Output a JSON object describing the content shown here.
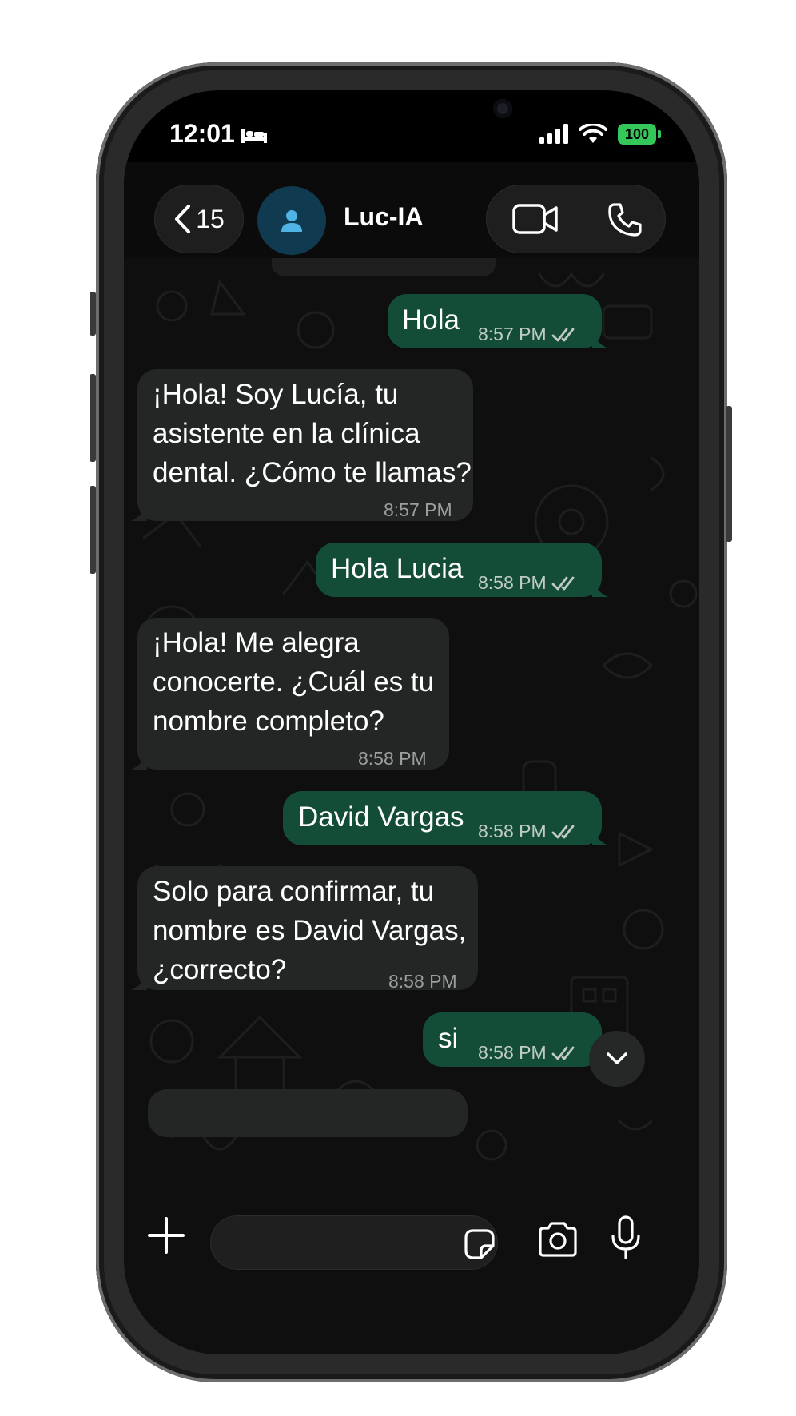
{
  "status_bar": {
    "time": "12:01",
    "battery": "100"
  },
  "header": {
    "back_count": "15",
    "contact_name": "Luc-IA"
  },
  "messages": [
    {
      "direction": "out",
      "text": "Hola",
      "time": "8:57 PM"
    },
    {
      "direction": "in",
      "text": "¡Hola! Soy Lucía, tu\nasistente en la clínica\ndental. ¿Cómo te llamas?",
      "time": "8:57 PM"
    },
    {
      "direction": "out",
      "text": "Hola Lucia",
      "time": "8:58 PM"
    },
    {
      "direction": "in",
      "text": "¡Hola! Me alegra\nconocerte. ¿Cuál es tu\nnombre completo?",
      "time": "8:58 PM"
    },
    {
      "direction": "out",
      "text": "David Vargas",
      "time": "8:58 PM"
    },
    {
      "direction": "in",
      "text": "Solo para confirmar, tu\nnombre es David Vargas,\n¿correcto?",
      "time": "8:58 PM"
    },
    {
      "direction": "out",
      "text": "si",
      "time": "8:58 PM"
    }
  ],
  "composer": {
    "placeholder": ""
  },
  "colors": {
    "outgoing_bubble": "#144d37",
    "incoming_bubble": "#242626",
    "read_ticks": "#c0cbc5",
    "avatar_bg": "#103a4f",
    "avatar_icon": "#4fb3e6",
    "battery": "#34c759"
  },
  "icons": [
    "bed-icon",
    "signal-icon",
    "wifi-icon",
    "battery-icon",
    "chevron-left-icon",
    "person-icon",
    "video-call-icon",
    "phone-call-icon",
    "double-check-icon",
    "chevron-down-icon",
    "plus-icon",
    "sticker-icon",
    "camera-icon",
    "microphone-icon"
  ]
}
